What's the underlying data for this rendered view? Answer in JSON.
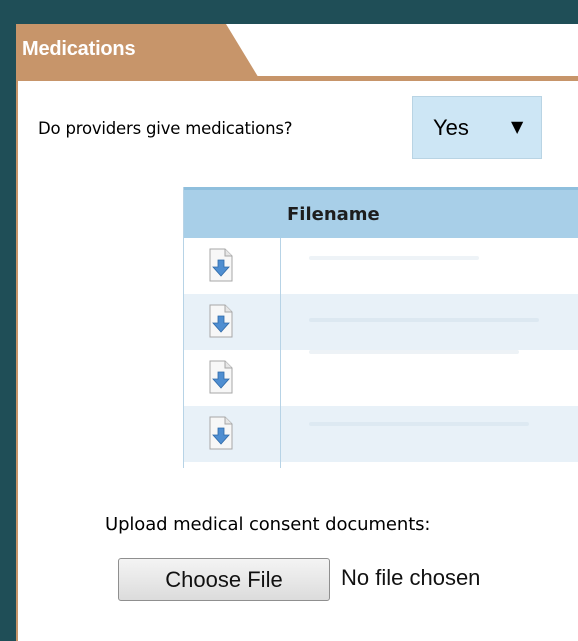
{
  "section": {
    "tab_label": "Medications"
  },
  "medications": {
    "question": "Do providers give medications?",
    "answer": "Yes",
    "dropdown_arrow": "▼"
  },
  "files": {
    "header": "Filename",
    "rows": [
      {
        "icon": "download-file-icon"
      },
      {
        "icon": "download-file-icon"
      },
      {
        "icon": "download-file-icon"
      },
      {
        "icon": "download-file-icon"
      }
    ]
  },
  "upload": {
    "label": "Upload medical consent documents:",
    "button_label": "Choose File",
    "status": "No file chosen"
  },
  "colors": {
    "page_background": "#1f4e57",
    "tab_background": "#c7956a",
    "select_background": "#cde6f5",
    "table_header": "#a8cfe8",
    "alt_row": "#e8f1f8"
  }
}
